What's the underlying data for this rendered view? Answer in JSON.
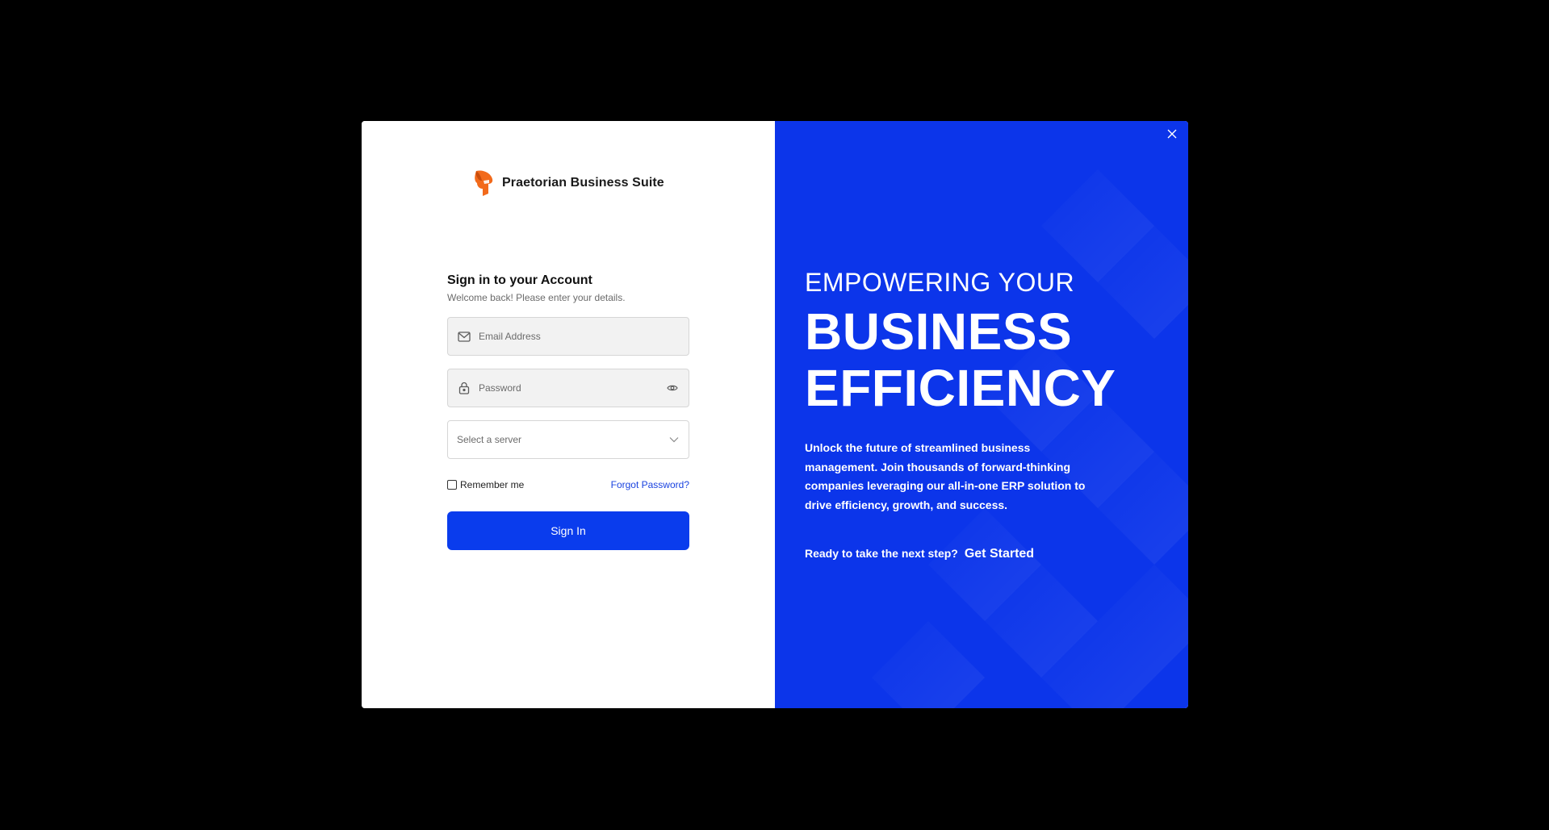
{
  "brand": {
    "name": "Praetorian Business Suite",
    "logo_icon": "spartan-helmet-icon",
    "logo_color": "#f26a1b"
  },
  "login": {
    "title": "Sign in to your Account",
    "subtitle": "Welcome back! Please enter your details.",
    "email": {
      "placeholder": "Email Address",
      "value": "",
      "icon": "mail-icon"
    },
    "password": {
      "placeholder": "Password",
      "value": "",
      "icon": "lock-icon",
      "toggle_icon": "eye-icon"
    },
    "server": {
      "selected": "Select a server",
      "icon": "chevron-down-icon"
    },
    "remember_label": "Remember me",
    "remember_checked": false,
    "forgot_label": "Forgot Password?",
    "submit_label": "Sign In"
  },
  "promo": {
    "pre_heading": "EMPOWERING YOUR",
    "heading_line1": "BUSINESS",
    "heading_line2": "EFFICIENCY",
    "description": "Unlock the future of streamlined business management. Join thousands of forward-thinking companies leveraging our all-in-one ERP solution to drive efficiency, growth, and success.",
    "cta_text": "Ready to take the next step?",
    "cta_link": "Get Started",
    "close_icon": "close-icon"
  },
  "colors": {
    "accent": "#0a3ced",
    "promo_background": "#0c35ea",
    "link": "#1a43e0",
    "page_background": "#000000"
  }
}
